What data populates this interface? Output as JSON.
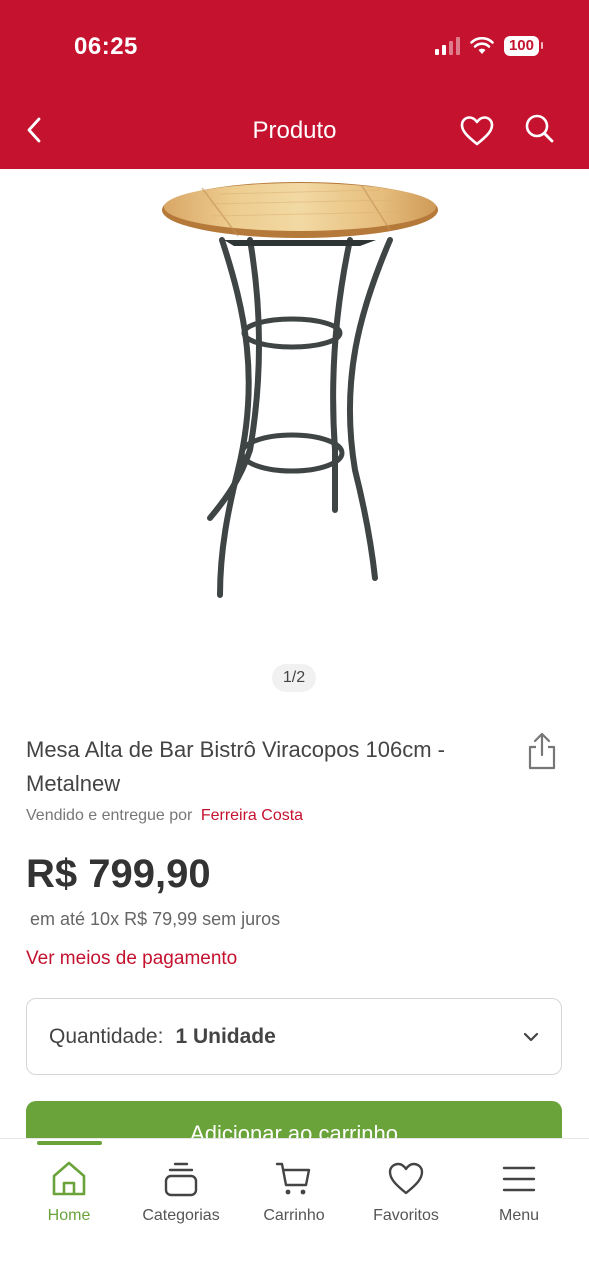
{
  "status_bar": {
    "time": "06:25",
    "battery": "100"
  },
  "header": {
    "title": "Produto"
  },
  "gallery": {
    "pager": "1/2"
  },
  "product": {
    "title": "Mesa Alta de Bar Bistrô Viracopos 106cm - Metalnew",
    "seller_prefix": "Vendido e entregue por",
    "seller_name": "Ferreira Costa",
    "price": "R$ 799,90",
    "installments_prefix": "em até",
    "installments_value": "10x R$ 79,99 sem juros",
    "payment_link": "Ver meios de pagamento"
  },
  "quantity": {
    "label": "Quantidade:",
    "value": "1 Unidade"
  },
  "add_to_cart": {
    "label": "Adicionar ao carrinho"
  },
  "tabs": [
    {
      "label": "Home",
      "icon": "home-icon",
      "active": true
    },
    {
      "label": "Categorias",
      "icon": "categories-icon",
      "active": false
    },
    {
      "label": "Carrinho",
      "icon": "cart-icon",
      "active": false
    },
    {
      "label": "Favoritos",
      "icon": "heart-icon",
      "active": false
    },
    {
      "label": "Menu",
      "icon": "hamburger-menu-icon",
      "active": false
    }
  ],
  "colors": {
    "brand": "#c4122f",
    "accent": "#6aa33a"
  }
}
